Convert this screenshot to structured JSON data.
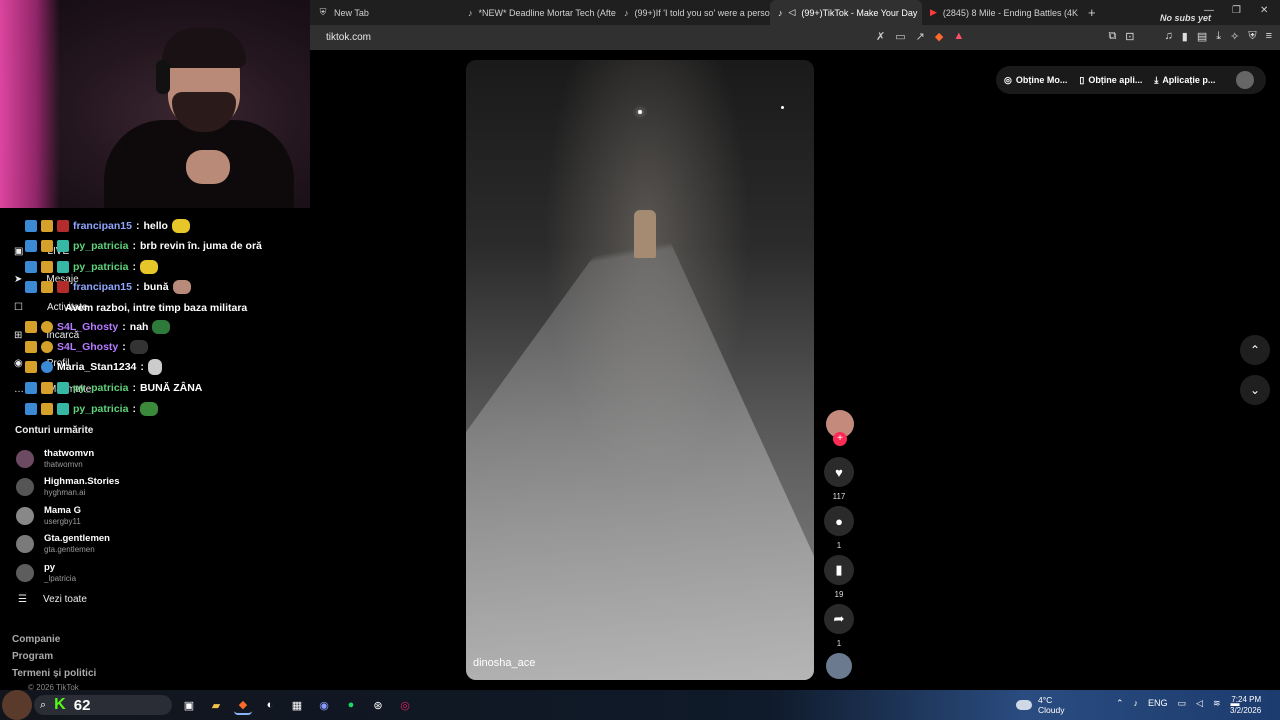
{
  "browser": {
    "tabs": [
      {
        "icon": "shield-icon",
        "label": "New Tab"
      },
      {
        "icon": "tiktok-icon",
        "label": "*NEW* Deadline Mortar Tech (After p"
      },
      {
        "icon": "tiktok-icon",
        "label": "(99+)If 'I told you so' were a person."
      },
      {
        "icon": "tiktok-icon",
        "label": "(99+)TikTok - Make Your Day",
        "active": true
      },
      {
        "icon": "youtube-icon",
        "label": "(2845) 8 Mile - Ending Battles (4K/U"
      }
    ],
    "overlay_text": "No subs yet",
    "url": "tiktok.com"
  },
  "chat": [
    {
      "name": "francipan15",
      "text": "hello",
      "name_color": "green"
    },
    {
      "name": "py_patricia",
      "text": "brb revin în. juma de oră",
      "name_color": "green"
    },
    {
      "name": "py_patricia",
      "text": "",
      "name_color": "green"
    },
    {
      "name": "francipan15",
      "text": "bună",
      "name_color": "blue"
    },
    {
      "name": "",
      "text": "Avem razboi, intre timp baza militara",
      "name_color": "white"
    },
    {
      "name": "S4L_Ghosty",
      "text": "nah",
      "name_color": "purple"
    },
    {
      "name": "S4L_Ghosty",
      "text": "",
      "name_color": "purple"
    },
    {
      "name": "Maria_Stan1234",
      "text": "",
      "name_color": "white"
    },
    {
      "name": "py_patricia",
      "text": "BUNĂ ZÂNA",
      "name_color": "green"
    },
    {
      "name": "py_patricia",
      "text": "",
      "name_color": "green"
    }
  ],
  "sidebar_nav": [
    "LIVE",
    "Mesaje",
    "Activitate",
    "Încarcă",
    "Profil",
    "Mai multe"
  ],
  "followed": {
    "title": "Conturi urmărite",
    "accounts": [
      {
        "name": "thatwomvn",
        "handle": "thatwomvn"
      },
      {
        "name": "Highman.Stories",
        "handle": "hyghman.ai"
      },
      {
        "name": "Mama G",
        "handle": "usergby11"
      },
      {
        "name": "Gta.gentlemen",
        "handle": "gta.gentlemen"
      },
      {
        "name": "py",
        "handle": "_lpatricia"
      }
    ],
    "see_all": "Vezi toate"
  },
  "footer_links": [
    "Companie",
    "Program",
    "Termeni și politici"
  ],
  "footer_copyright": "© 2026 TikTok",
  "header_actions": [
    "Obține Mo...",
    "Obține apli...",
    "Aplicație p..."
  ],
  "video": {
    "creator": "dinosha_ace"
  },
  "actions": {
    "likes": "117",
    "comments": "1",
    "saves": "19",
    "shares": "1"
  },
  "taskbar": {
    "kick_viewers": "62",
    "weather_temp": "4°C",
    "weather_desc": "Cloudy",
    "lang": "ENG",
    "time": "7:24 PM",
    "date": "3/2/2026"
  }
}
